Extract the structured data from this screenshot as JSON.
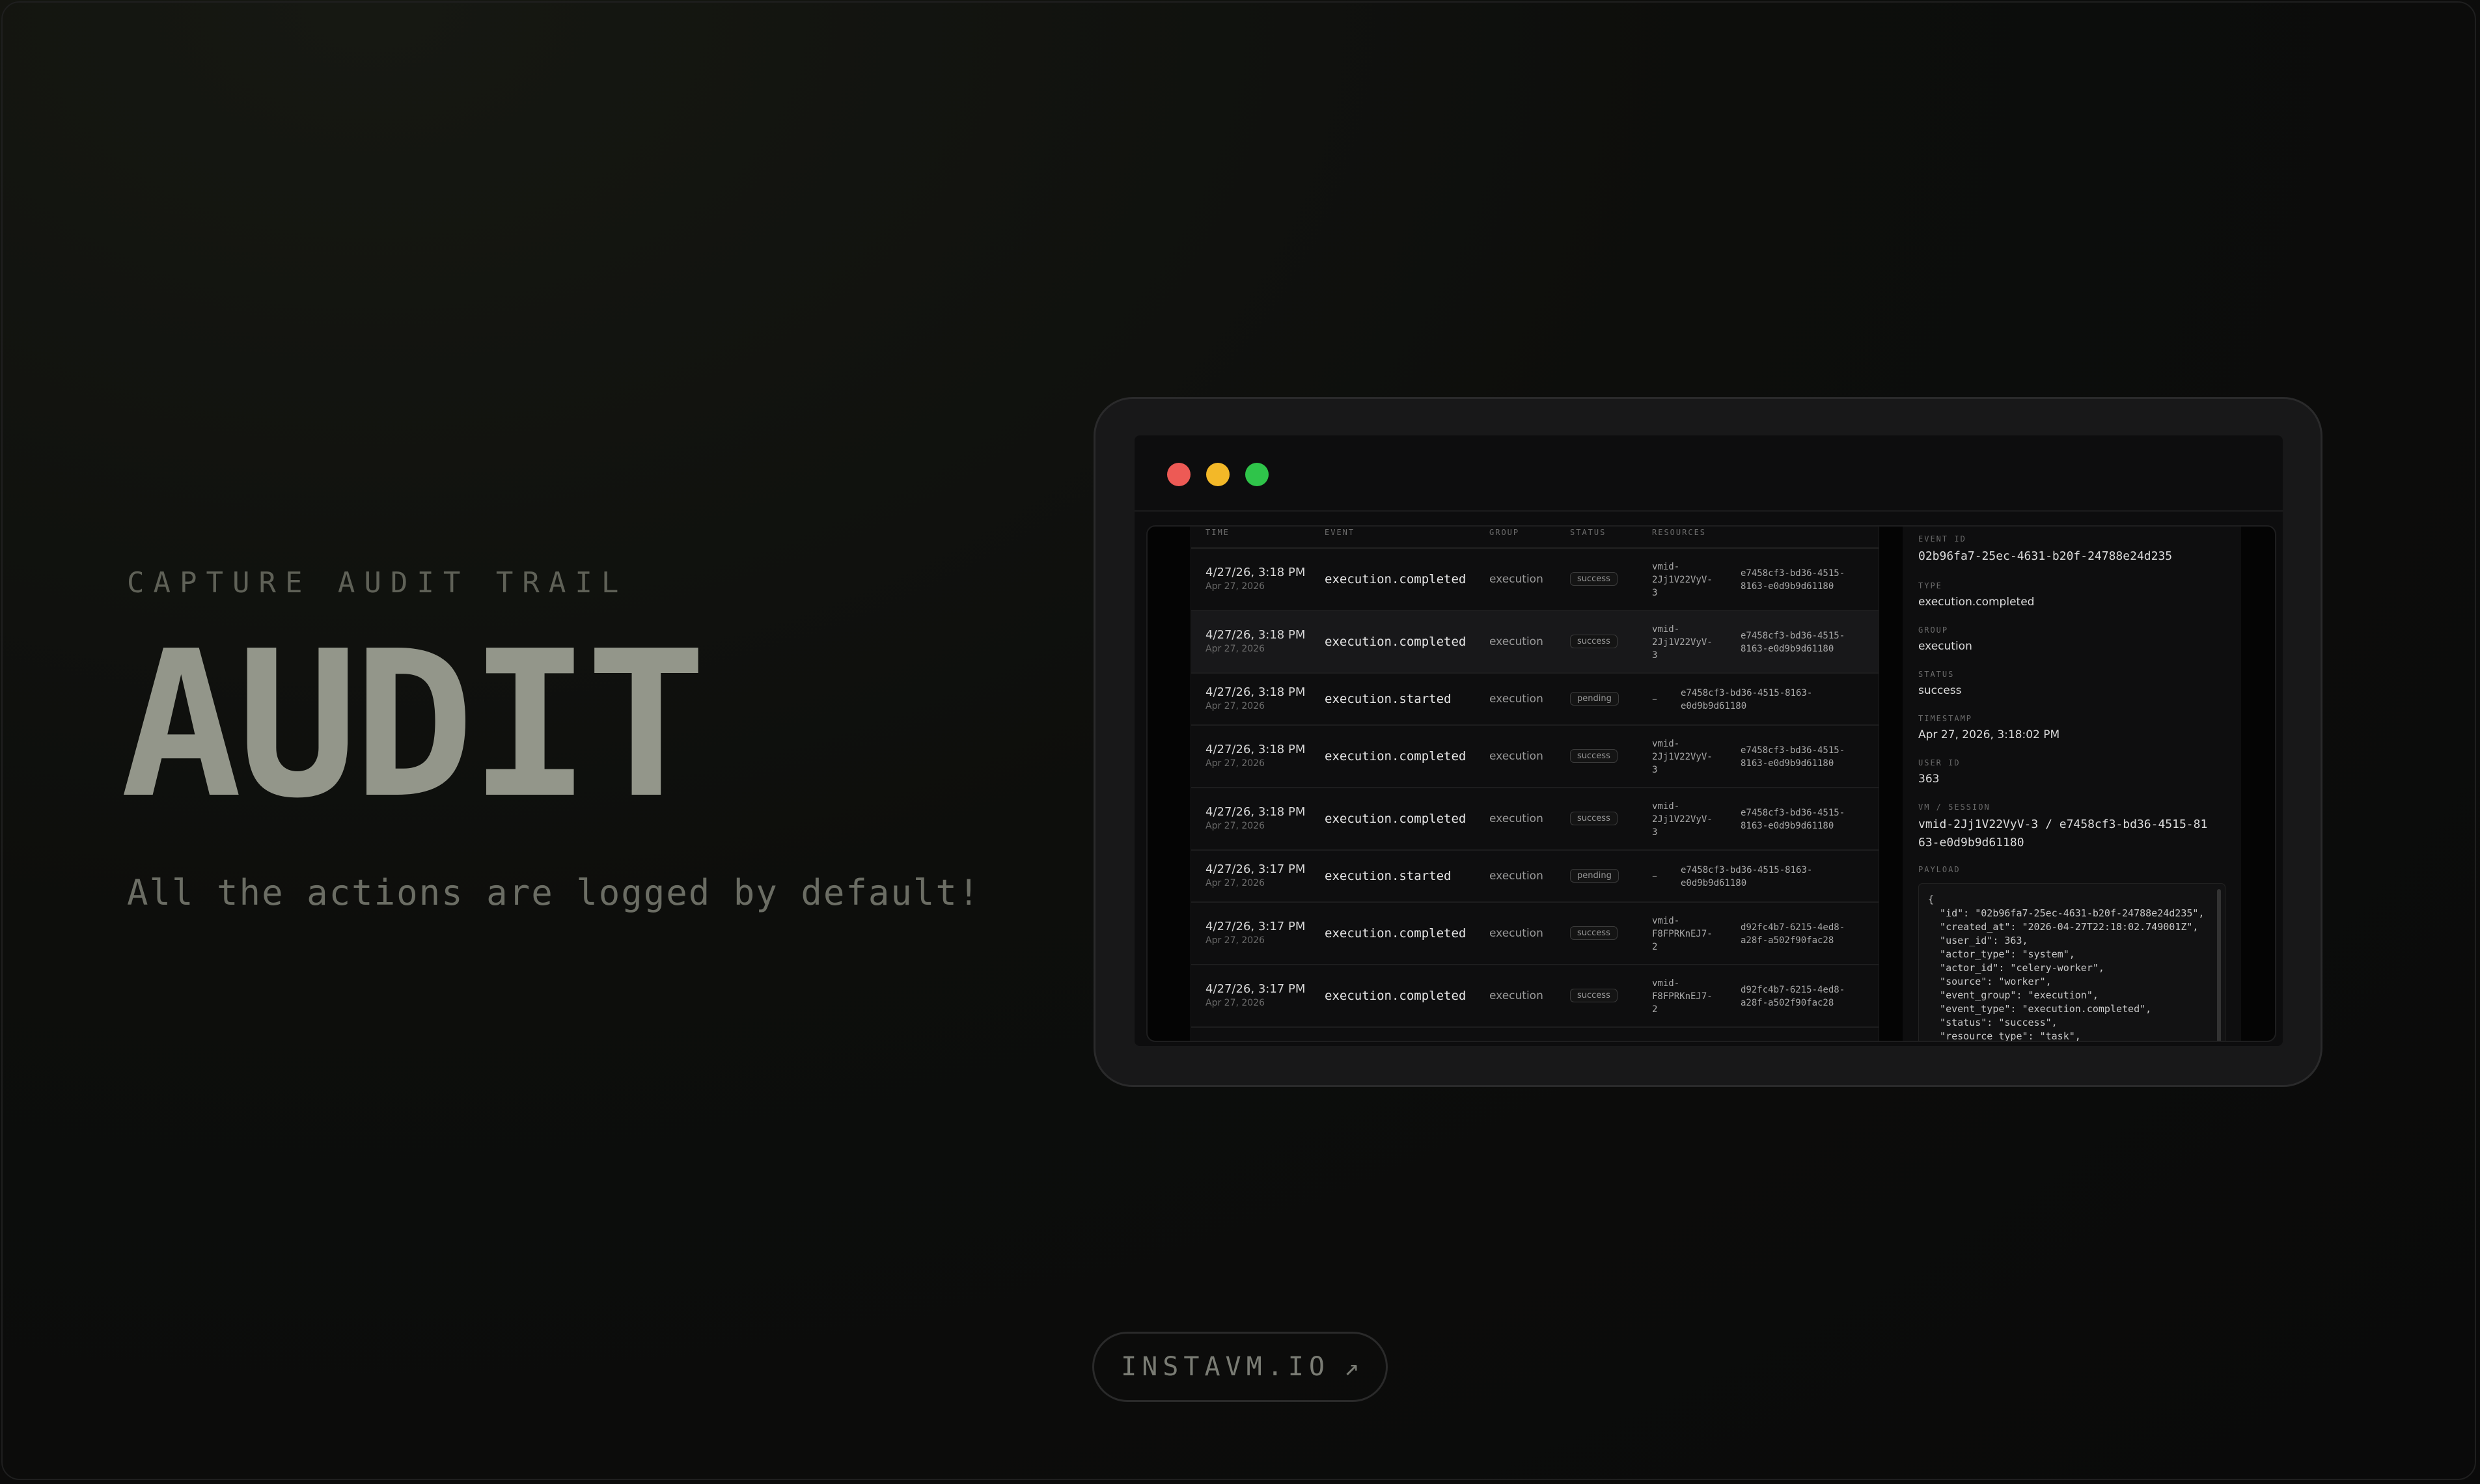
{
  "hero": {
    "eyebrow": "CAPTURE AUDIT TRAIL",
    "title": "AUDIT",
    "tagline": "All the actions are logged by default!"
  },
  "cta": {
    "label": "INSTAVM.IO",
    "arrow": "↗"
  },
  "window": {
    "buttons": [
      "close",
      "minimize",
      "maximize"
    ],
    "colors": {
      "close": "#ed5a55",
      "minimize": "#f3b828",
      "maximize": "#2fc44a"
    }
  },
  "table": {
    "headers": [
      "TIME",
      "EVENT",
      "GROUP",
      "STATUS",
      "RESOURCES"
    ],
    "rows": [
      {
        "time": "4/27/26, 3:18 PM",
        "date": "Apr 27, 2026",
        "event": "execution.completed",
        "group": "execution",
        "status": "success",
        "vm": "vmid-\n2Jj1V22VyV-\n3",
        "session": "e7458cf3-bd36-4515-\n8163-e0d9b9d61180"
      },
      {
        "time": "4/27/26, 3:18 PM",
        "date": "Apr 27, 2026",
        "event": "execution.completed",
        "group": "execution",
        "status": "success",
        "vm": "vmid-\n2Jj1V22VyV-\n3",
        "session": "e7458cf3-bd36-4515-\n8163-e0d9b9d61180"
      },
      {
        "time": "4/27/26, 3:18 PM",
        "date": "Apr 27, 2026",
        "event": "execution.started",
        "group": "execution",
        "status": "pending",
        "vm": "–",
        "session": "e7458cf3-bd36-4515-8163-\ne0d9b9d61180"
      },
      {
        "time": "4/27/26, 3:18 PM",
        "date": "Apr 27, 2026",
        "event": "execution.completed",
        "group": "execution",
        "status": "success",
        "vm": "vmid-\n2Jj1V22VyV-\n3",
        "session": "e7458cf3-bd36-4515-\n8163-e0d9b9d61180"
      },
      {
        "time": "4/27/26, 3:18 PM",
        "date": "Apr 27, 2026",
        "event": "execution.completed",
        "group": "execution",
        "status": "success",
        "vm": "vmid-\n2Jj1V22VyV-\n3",
        "session": "e7458cf3-bd36-4515-\n8163-e0d9b9d61180"
      },
      {
        "time": "4/27/26, 3:17 PM",
        "date": "Apr 27, 2026",
        "event": "execution.started",
        "group": "execution",
        "status": "pending",
        "vm": "–",
        "session": "e7458cf3-bd36-4515-8163-\ne0d9b9d61180"
      },
      {
        "time": "4/27/26, 3:17 PM",
        "date": "Apr 27, 2026",
        "event": "execution.completed",
        "group": "execution",
        "status": "success",
        "vm": "vmid-\nF8FPRKnEJ7-\n2",
        "session": "d92fc4b7-6215-4ed8-\na28f-a502f90fac28"
      },
      {
        "time": "4/27/26, 3:17 PM",
        "date": "Apr 27, 2026",
        "event": "execution.completed",
        "group": "execution",
        "status": "success",
        "vm": "vmid-\nF8FPRKnEJ7-\n2",
        "session": "d92fc4b7-6215-4ed8-\na28f-a502f90fac28"
      }
    ]
  },
  "detail": {
    "event_id_label": "EVENT ID",
    "event_id": "02b96fa7-25ec-4631-b20f-24788e24d235",
    "type_label": "TYPE",
    "type": "execution.completed",
    "group_label": "GROUP",
    "group": "execution",
    "status_label": "STATUS",
    "status": "success",
    "timestamp_label": "TIMESTAMP",
    "timestamp": "Apr 27, 2026, 3:18:02 PM",
    "user_id_label": "USER ID",
    "user_id": "363",
    "vm_session_label": "VM / SESSION",
    "vm_session": "vmid-2Jj1V22VyV-3 / e7458cf3-bd36-4515-81\n63-e0d9b9d61180",
    "payload_label": "PAYLOAD",
    "payload": "{\n  \"id\": \"02b96fa7-25ec-4631-b20f-24788e24d235\",\n  \"created_at\": \"2026-04-27T22:18:02.749001Z\",\n  \"user_id\": 363,\n  \"actor_type\": \"system\",\n  \"actor_id\": \"celery-worker\",\n  \"source\": \"worker\",\n  \"event_group\": \"execution\",\n  \"event_type\": \"execution.completed\",\n  \"status\": \"success\",\n  \"resource_type\": \"task\","
  }
}
